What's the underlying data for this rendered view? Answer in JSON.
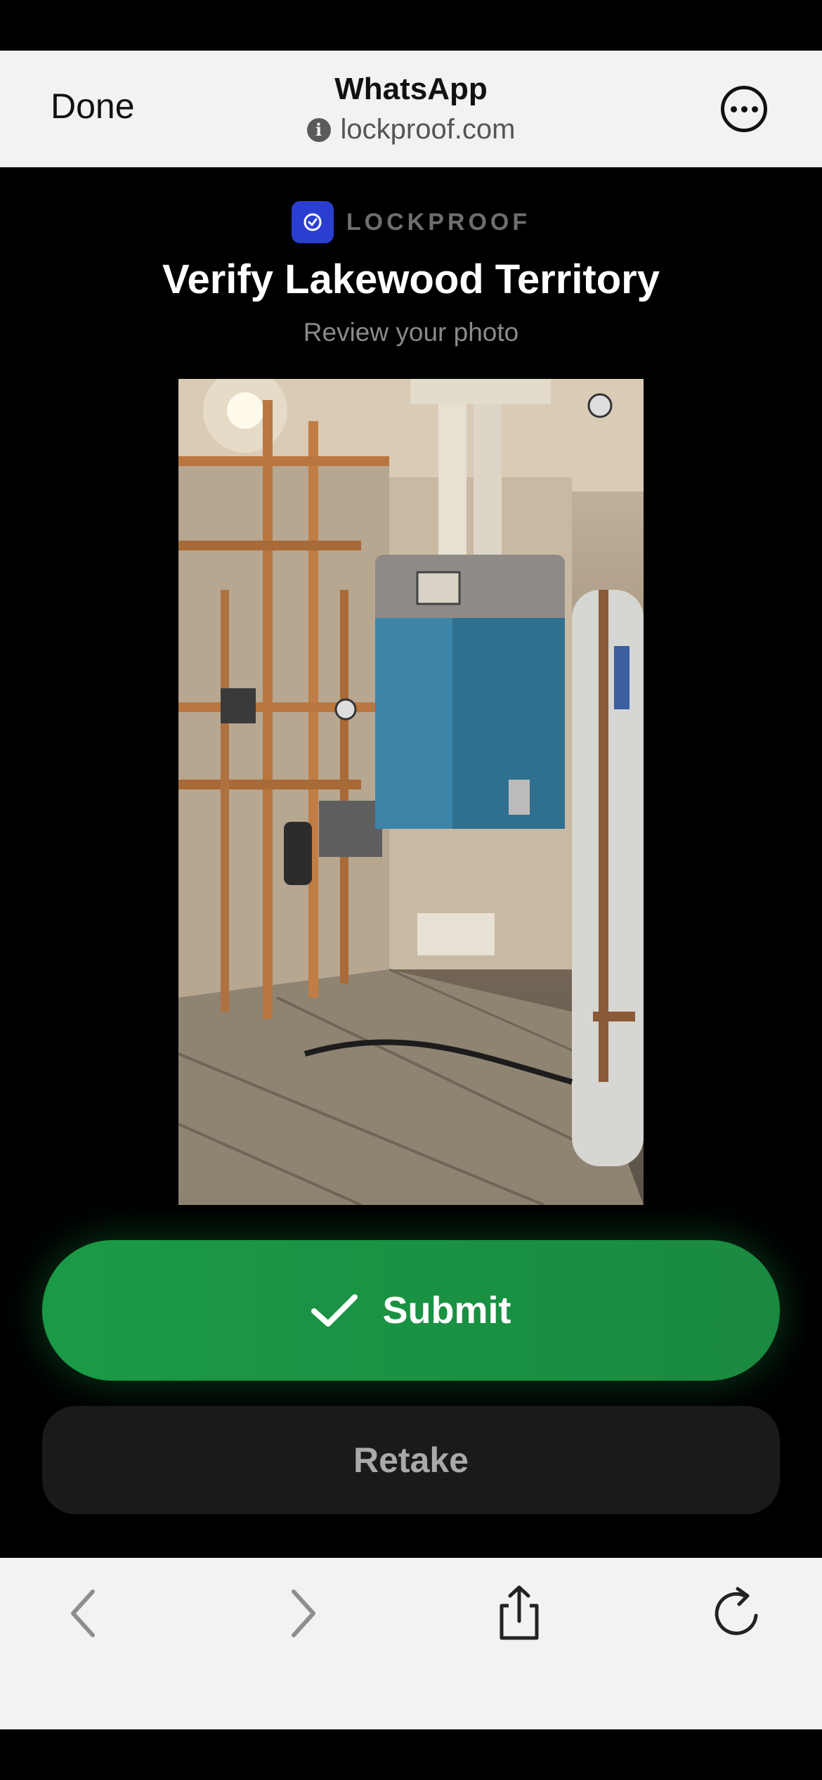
{
  "browser": {
    "done_label": "Done",
    "title": "WhatsApp",
    "url": "lockproof.com"
  },
  "brand": {
    "name": "LOCKPROOF",
    "logo_color": "#2a3fd0"
  },
  "page": {
    "title": "Verify Lakewood Territory",
    "subtitle": "Review your photo"
  },
  "photo": {
    "description_icon": "boiler-room-photo"
  },
  "actions": {
    "submit_label": "Submit",
    "retake_label": "Retake",
    "submit_color": "#1a9a46"
  },
  "toolbar": {
    "items": [
      "back-icon",
      "forward-icon",
      "share-icon",
      "reload-icon"
    ]
  }
}
